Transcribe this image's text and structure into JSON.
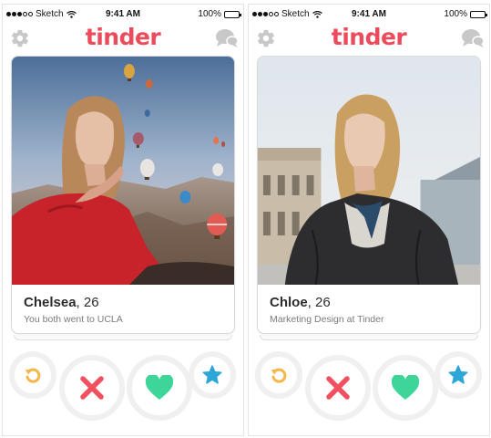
{
  "status_bar": {
    "carrier": "Sketch",
    "time": "9:41 AM",
    "battery": "100%"
  },
  "app": {
    "logo": "tinder"
  },
  "profiles": [
    {
      "name": "Chelsea",
      "age": ", 26",
      "subtitle": "You both went to UCLA"
    },
    {
      "name": "Chloe",
      "age": ", 26",
      "subtitle": "Marketing Design at Tinder"
    }
  ],
  "icons": {
    "settings": "gear-icon",
    "messages": "chat-bubble-icon",
    "rewind": "rewind-icon",
    "nope": "x-icon",
    "like": "heart-icon",
    "super_like": "star-icon"
  },
  "colors": {
    "brand": "#ec4b5b",
    "rewind": "#f5b748",
    "nope": "#f0505f",
    "like": "#3dd598",
    "super_like": "#2da6d8",
    "header_icon": "#c8c8c8"
  }
}
